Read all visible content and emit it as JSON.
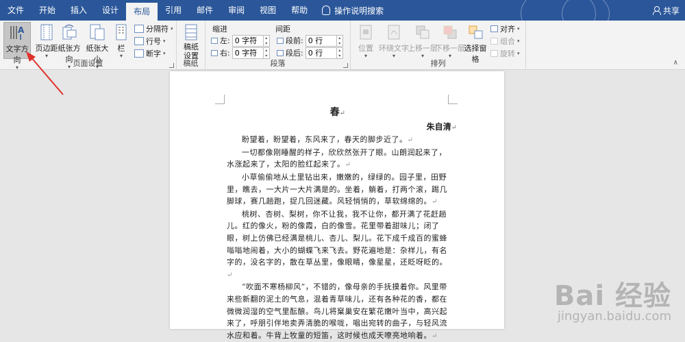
{
  "tabs": [
    "文件",
    "开始",
    "插入",
    "设计",
    "布局",
    "引用",
    "邮件",
    "审阅",
    "视图",
    "帮助"
  ],
  "active_tab": "布局",
  "tell_me": "操作说明搜索",
  "share": "共享",
  "ribbon": {
    "page_setup": {
      "text_direction": "文字方向",
      "margins": "页边距",
      "orientation": "纸张方向",
      "size": "纸张大小",
      "columns": "栏",
      "breaks": "分隔符",
      "line_numbers": "行号",
      "hyphenation": "断字",
      "label": "页面设置"
    },
    "manuscript": {
      "button": "稿纸设置",
      "label": "稿纸"
    },
    "paragraph": {
      "indent_label": "缩进",
      "spacing_label": "间距",
      "left_label": "左:",
      "left_value": "0 字符",
      "right_label": "右:",
      "right_value": "0 字符",
      "before_label": "段前:",
      "before_value": "0 行",
      "after_label": "段后:",
      "after_value": "0 行",
      "label": "段落"
    },
    "arrange": {
      "position": "位置",
      "wrap_text": "环绕文字",
      "bring_forward": "上移一层",
      "send_backward": "下移一层",
      "selection_pane": "选择窗格",
      "align": "对齐",
      "group": "组合",
      "rotate": "旋转",
      "label": "排列"
    }
  },
  "document": {
    "title": "春",
    "author": "朱自清",
    "paragraphs": [
      "盼望着，盼望着，东风来了，春天的脚步近了。",
      "一切都像刚睡醒的样子，欣欣然张开了眼。山朗润起来了，水涨起来了，太阳的脸红起来了。",
      "小草偷偷地从土里钻出来，嫩嫩的，绿绿的。园子里，田野里，瞧去，一大片一大片满是的。坐着，躺着，打两个滚，踢几脚球，赛几趟跑，捉几回迷藏。风轻悄悄的，草软绵绵的。",
      "桃树、杏树、梨树，你不让我，我不让你，都开满了花赶趟儿。红的像火，粉的像霞，白的像雪。花里带着甜味儿；闭了眼，树上仿佛已经满是桃儿、杏儿、梨儿。花下成千成百的蜜蜂嗡嗡地闹着，大小的蝴蝶飞来飞去。野花遍地是：杂样儿，有名字的，没名字的，散在草丛里，像眼睛，像星星，还眨呀眨的。",
      "“吹面不寒杨柳风”，不错的，像母亲的手抚摸着你。风里带来些新翻的泥土的气息，混着青草味儿，还有各种花的香，都在微微润湿的空气里酝酿。鸟儿将窠巢安在繁花嫩叶当中，高兴起来了，呼朋引伴地卖弄清脆的喉咙，唱出宛转的曲子，与轻风流水应和着。牛背上牧童的短笛，这时候也成天嘹亮地响着。"
    ]
  },
  "watermark": {
    "brand": "Bai 经验",
    "url": "jingyan.baidu.com"
  },
  "colors": {
    "tab_bar": "#2b579a",
    "ribbon": "#f3f3f3",
    "annotation_arrow": "#e0312b"
  }
}
